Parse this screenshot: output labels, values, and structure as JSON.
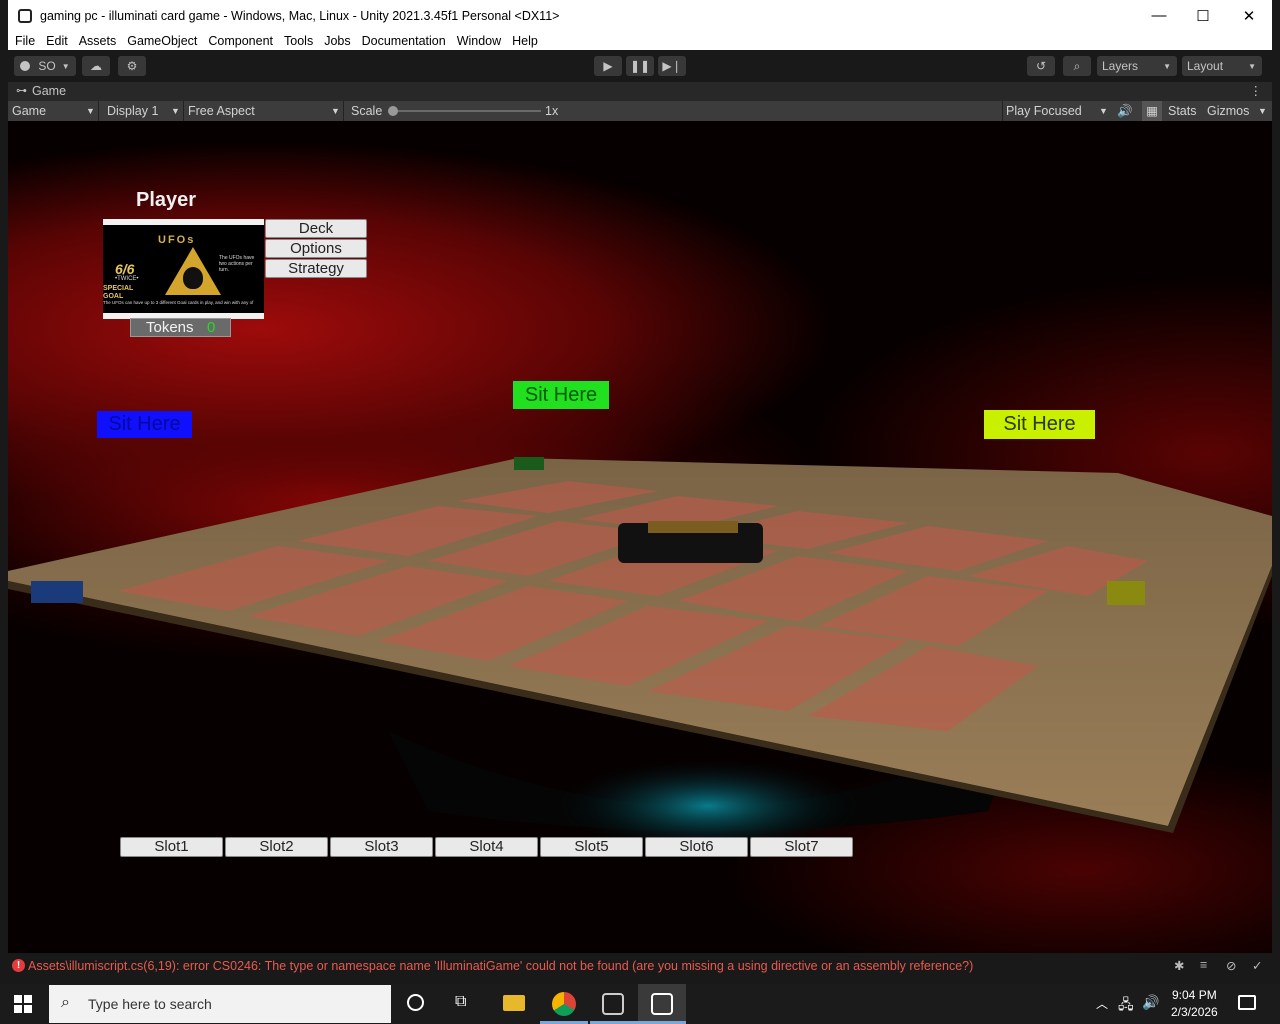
{
  "window": {
    "title": "gaming pc - illuminati card game - Windows, Mac, Linux - Unity 2021.3.45f1 Personal <DX11>",
    "minimize": "—",
    "maximize": "☐",
    "close": "✕"
  },
  "menu": [
    "File",
    "Edit",
    "Assets",
    "GameObject",
    "Component",
    "Tools",
    "Jobs",
    "Documentation",
    "Window",
    "Help"
  ],
  "toolbar": {
    "account_label": "SO",
    "layers_label": "Layers",
    "layout_label": "Layout"
  },
  "game_tab": {
    "label": "Game"
  },
  "game_options": {
    "view": "Game",
    "display": "Display 1",
    "aspect": "Free Aspect",
    "scale_label": "Scale",
    "scale_value": "1x",
    "play_mode": "Play Focused",
    "stats": "Stats",
    "gizmos": "Gizmos"
  },
  "game": {
    "player_label": "Player",
    "card": {
      "name": "UFOs",
      "power": "6/6",
      "twice": "•TWICE•",
      "goal": "SPECIAL GOAL",
      "text": "The UFOs have two actions per turn.",
      "footer": "The UFOs can have up to 3 different Goal cards in play, and win with any of"
    },
    "buttons": {
      "deck": "Deck",
      "options": "Options",
      "strategy": "Strategy"
    },
    "tokens_label": "Tokens",
    "tokens_value": "0",
    "sit_blue": "Sit Here",
    "sit_green": "Sit Here",
    "sit_yellow": "Sit Here",
    "slots": [
      "Slot1",
      "Slot2",
      "Slot3",
      "Slot4",
      "Slot5",
      "Slot6",
      "Slot7"
    ]
  },
  "console": {
    "error": "Assets\\illumiscript.cs(6,19): error CS0246: The type or namespace name 'IlluminatiGame' could not be found (are you missing a using directive or an assembly reference?)"
  },
  "taskbar": {
    "search_placeholder": "Type here to search",
    "time": "9:04 PM",
    "date": "2/3/2026"
  },
  "colors": {
    "sit_blue": "#1010ff",
    "sit_green": "#20e020",
    "sit_yellow": "#c8f000",
    "tokens_value": "#22dd22"
  }
}
